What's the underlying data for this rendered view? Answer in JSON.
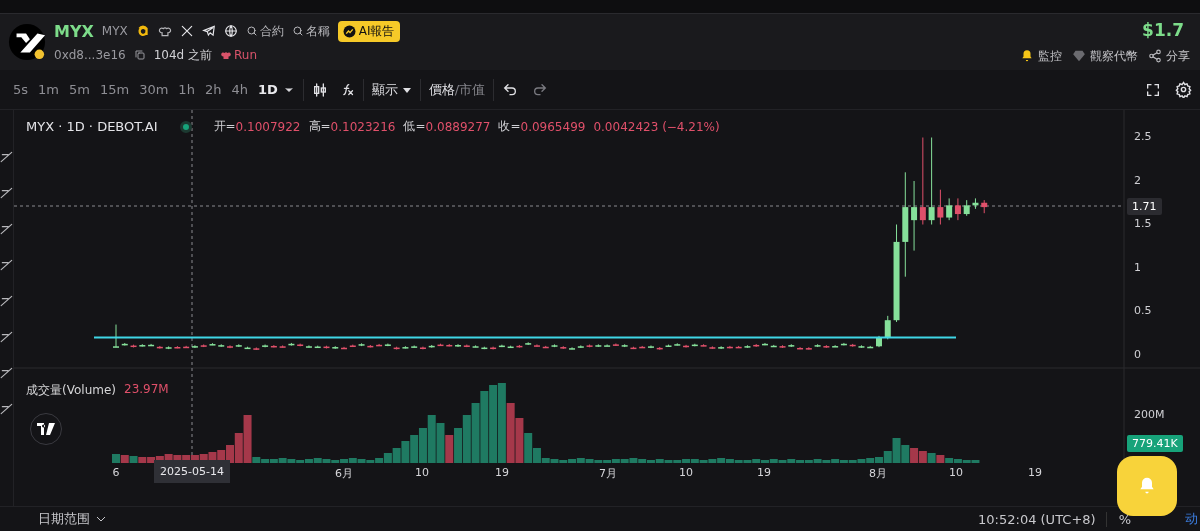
{
  "header": {
    "name": "MYX",
    "symbol": "MYX",
    "search_links": [
      {
        "label": "合約"
      },
      {
        "label": "名稱"
      }
    ],
    "ai_button": "AI報告",
    "address": "0xd8...3e16",
    "age": "104d 之前",
    "run_label": "Run",
    "price": "$1.7",
    "actions": [
      {
        "kind": "bell",
        "label": "監控"
      },
      {
        "kind": "diamond",
        "label": "觀察代幣"
      },
      {
        "kind": "share",
        "label": "分享"
      }
    ]
  },
  "toolbar": {
    "intervals": [
      {
        "label": "5s",
        "selected": false
      },
      {
        "label": "1m",
        "selected": false
      },
      {
        "label": "5m",
        "selected": false
      },
      {
        "label": "15m",
        "selected": false
      },
      {
        "label": "30m",
        "selected": false
      },
      {
        "label": "1h",
        "selected": false
      },
      {
        "label": "2h",
        "selected": false
      },
      {
        "label": "4h",
        "selected": false
      },
      {
        "label": "1D",
        "selected": true
      }
    ],
    "display_menu": "顯示",
    "modes": [
      {
        "label": "價格",
        "selected": true
      },
      {
        "label": "市值",
        "selected": false
      }
    ],
    "mode_separator": "/"
  },
  "chart": {
    "title": "MYX · 1D · DEBOT.AI",
    "ohlc": [
      {
        "label": "开=",
        "value": "0.1007922"
      },
      {
        "label": "高=",
        "value": "0.1023216"
      },
      {
        "label": "低=",
        "value": "0.0889277"
      },
      {
        "label": "收=",
        "value": "0.0965499"
      }
    ],
    "change": "0.0042423 (−4.21%)",
    "price_ticks": [
      "2.5",
      "2",
      "1.5",
      "1",
      "0.5",
      "0"
    ],
    "last_price": "1.71",
    "volume_label": "成交量(Volume)",
    "volume_value": "23.97M",
    "volume_ticks": [
      "200M"
    ],
    "last_volume": "779.41K",
    "x_labels": [
      "6",
      "6月",
      "10",
      "19",
      "7月",
      "10",
      "19",
      "8月",
      "10",
      "19"
    ],
    "crosshair_date": "2025-05-14"
  },
  "footer": {
    "date_range": "日期范围",
    "time": "10:52:04 (UTC+8)",
    "percent": "%",
    "auto": "动"
  }
}
